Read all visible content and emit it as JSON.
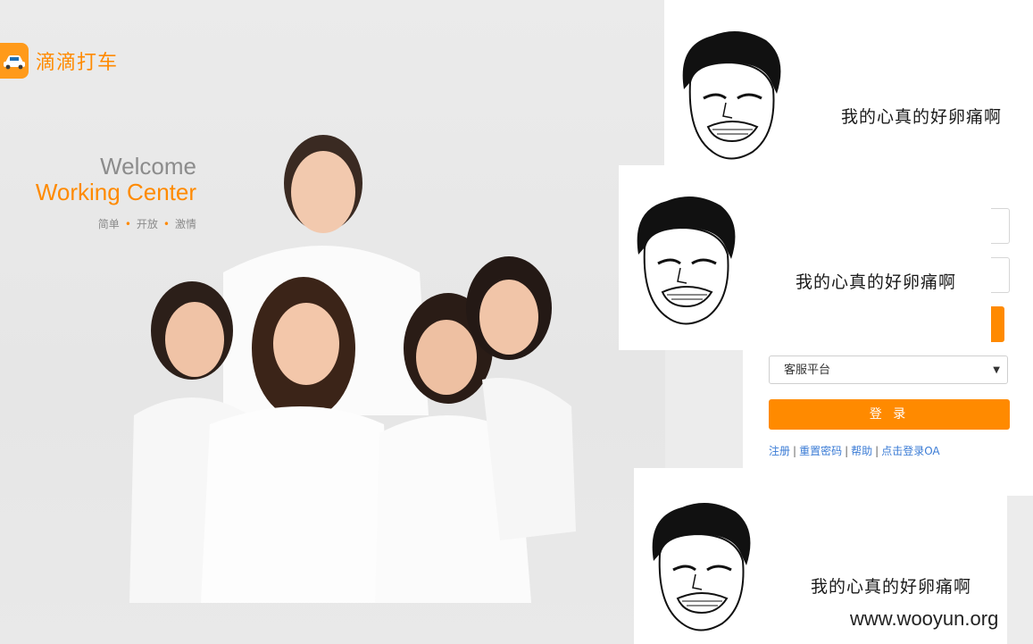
{
  "brand": {
    "name": "滴滴打车",
    "logo_icon": "taxi-car-icon",
    "color": "#ff8a00"
  },
  "welcome": {
    "line1": "Welcome",
    "line2": "Working Center",
    "slogan": [
      "简单",
      "开放",
      "激情"
    ]
  },
  "login": {
    "platform_select": {
      "value": "客服平台"
    },
    "submit_label": "登 录",
    "links": [
      "注册",
      "重置密码",
      "帮助",
      "点击登录OA"
    ],
    "link_separator": "|"
  },
  "meme_caption": "我的心真的好卵痛啊",
  "watermark": "www.wooyun.org"
}
